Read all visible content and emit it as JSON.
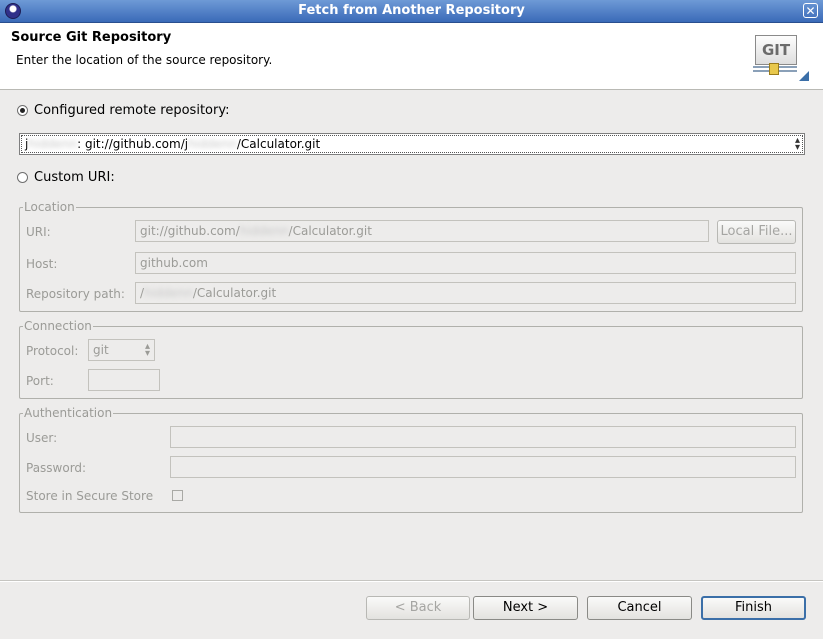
{
  "window": {
    "title": "Fetch from Another Repository",
    "close_glyph": "✕"
  },
  "header": {
    "title": "Source Git Repository",
    "description": "Enter the location of the source repository.",
    "logo_text": "GIT"
  },
  "configured_remote": {
    "label": "Configured remote repository:",
    "selected": true,
    "combo_value": {
      "prefix": "j",
      "blur1": "hiddenn",
      "mid": ": git://github.com/j",
      "blur2": "hiddenn",
      "suffix": "/Calculator.git"
    }
  },
  "custom_uri": {
    "label": "Custom URI:",
    "selected": false
  },
  "location": {
    "legend": "Location",
    "uri_label": "URI:",
    "uri_value": {
      "pre": "git://github.com/",
      "blur": "hiddenn",
      "post": "/Calculator.git"
    },
    "local_file_button": "Local File...",
    "host_label": "Host:",
    "host_value": "github.com",
    "repo_path_label": "Repository path:",
    "repo_path_value": {
      "pre": "/",
      "blur": "hiddenn",
      "post": "/Calculator.git"
    }
  },
  "connection": {
    "legend": "Connection",
    "protocol_label": "Protocol:",
    "protocol_value": "git",
    "port_label": "Port:",
    "port_value": ""
  },
  "authentication": {
    "legend": "Authentication",
    "user_label": "User:",
    "user_value": "",
    "password_label": "Password:",
    "password_value": "",
    "secure_store_label": "Store in Secure Store",
    "secure_store_checked": false
  },
  "buttons": {
    "back": "< Back",
    "next": "Next >",
    "cancel": "Cancel",
    "finish": "Finish"
  },
  "colors": {
    "title_bar": "#3a6ab8",
    "default_button_border": "#3b6fa8",
    "disabled_text": "#9b9b97"
  }
}
